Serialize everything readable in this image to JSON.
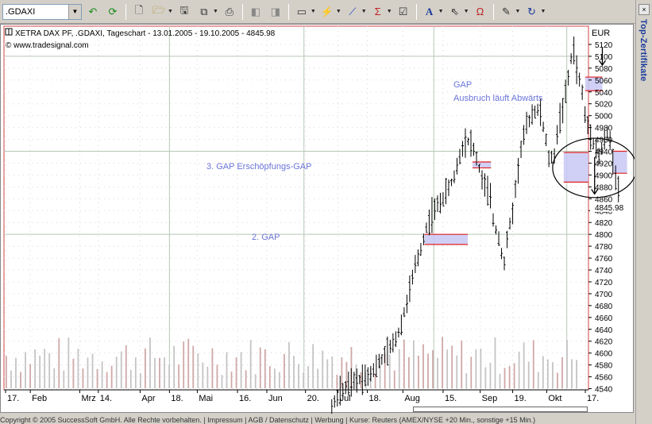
{
  "toolbar": {
    "symbol": ".GDAXI",
    "icons": [
      "undo-icon",
      "refresh-icon",
      "new-icon",
      "open-icon",
      "save-icon",
      "copy-icon",
      "print-icon",
      "chart-back-icon",
      "chart-forward-icon",
      "chart-type-icon",
      "indicator-icon",
      "sum-icon",
      "properties-icon",
      "text-tool-icon",
      "cursor-icon",
      "magnet-icon",
      "edit-icon",
      "reload-icon"
    ]
  },
  "side_tab": {
    "label": "Top-Zertifikate"
  },
  "header": {
    "title": "XETRA DAX PF, .GDAXI, Tageschart - 13.01.2005 - 19.10.2005 - 4845.98",
    "source": "© www.tradesignal.com",
    "currency": "EUR"
  },
  "annotations": {
    "gap_top": "GAP",
    "gap_top_sub": "Ausbruch läuft Abwärts",
    "gap3": "3. GAP Erschöpfungs-GAP",
    "gap2": "2. GAP"
  },
  "footer": {
    "text": "Copyright © 2005 SuccessSoft GmbH. Alle Rechte vorbehalten. | Impressum | AGB / Datenschutz | Werbung | Kurse: Reuters (AMEX/NYSE +20 Min., sonstige +15 Min.)"
  },
  "chart_data": {
    "type": "ohlc",
    "title": "XETRA DAX PF, .GDAXI, Tageschart - 13.01.2005 - 19.10.2005 - 4845.98",
    "ylabel": "EUR",
    "ylim": [
      4530,
      5140
    ],
    "yticks": [
      4540,
      4560,
      4580,
      4600,
      4620,
      4640,
      4660,
      4680,
      4700,
      4720,
      4740,
      4760,
      4780,
      4800,
      4820,
      4840,
      4860,
      4880,
      4900,
      4920,
      4940,
      4960,
      4980,
      5000,
      5020,
      5040,
      5060,
      5080,
      5100,
      5120
    ],
    "last_value": "4845.98",
    "xticks": [
      "17.",
      "Feb",
      "Mrz",
      "14.",
      "Apr",
      "18.",
      "Mai",
      "16.",
      "Jun",
      "20.",
      "Jul",
      "18.",
      "Aug",
      "15.",
      "Sep",
      "19.",
      "Okt",
      "17."
    ],
    "x_label_days": [
      0,
      16,
      48,
      60,
      87,
      106,
      124,
      150,
      169,
      194,
      215,
      234,
      257,
      283,
      307,
      328,
      350,
      375
    ],
    "x_grid_days": [
      106,
      193,
      277,
      363
    ],
    "last_day": 376,
    "price_knots": [
      [
        211,
        4510
      ],
      [
        216,
        4532
      ],
      [
        222,
        4545
      ],
      [
        228,
        4555
      ],
      [
        235,
        4565
      ],
      [
        240,
        4578
      ],
      [
        245,
        4595
      ],
      [
        250,
        4612
      ],
      [
        255,
        4640
      ],
      [
        260,
        4690
      ],
      [
        265,
        4745
      ],
      [
        268,
        4770
      ],
      [
        270,
        4790
      ],
      [
        272,
        4810
      ],
      [
        276,
        4835
      ],
      [
        280,
        4850
      ],
      [
        285,
        4870
      ],
      [
        290,
        4895
      ],
      [
        293,
        4925
      ],
      [
        297,
        4960
      ],
      [
        301,
        4955
      ],
      [
        305,
        4925
      ],
      [
        309,
        4885
      ],
      [
        313,
        4868
      ],
      [
        316,
        4815
      ],
      [
        320,
        4790
      ],
      [
        322,
        4740
      ],
      [
        325,
        4800
      ],
      [
        328,
        4840
      ],
      [
        331,
        4900
      ],
      [
        334,
        4955
      ],
      [
        338,
        4990
      ],
      [
        342,
        5010
      ],
      [
        346,
        5005
      ],
      [
        349,
        4965
      ],
      [
        352,
        4920
      ],
      [
        355,
        4935
      ],
      [
        358,
        4990
      ],
      [
        361,
        5020
      ],
      [
        363,
        5045
      ],
      [
        365,
        5080
      ],
      [
        367,
        5120
      ],
      [
        369,
        5085
      ],
      [
        371,
        5060
      ],
      [
        373,
        5040
      ],
      [
        375,
        4995
      ],
      [
        378,
        4975
      ],
      [
        381,
        4950
      ],
      [
        384,
        4930
      ],
      [
        387,
        4955
      ],
      [
        390,
        4972
      ],
      [
        393,
        4925
      ],
      [
        396,
        4880
      ],
      [
        398,
        4846
      ]
    ],
    "gap_boxes": [
      {
        "x1": 271,
        "x2": 299,
        "y1": 4783,
        "y2": 4800
      },
      {
        "x1": 302,
        "x2": 314,
        "y1": 4912,
        "y2": 4922
      },
      {
        "x1": 375,
        "x2": 386,
        "y1": 5042,
        "y2": 5065
      },
      {
        "x1": 361,
        "x2": 377,
        "y1": 4888,
        "y2": 4938
      },
      {
        "x1": 393,
        "x2": 402,
        "y1": 4903,
        "y2": 4940
      }
    ],
    "volume_max": 100,
    "arrows": [
      {
        "x": 386,
        "y_from": 5115,
        "y_to": 5085
      },
      {
        "x": 381,
        "y_from": 4930,
        "y_to": 4868
      }
    ],
    "circle": {
      "cx": 381,
      "cy": 4912,
      "rx": 27,
      "ry": 50
    }
  }
}
